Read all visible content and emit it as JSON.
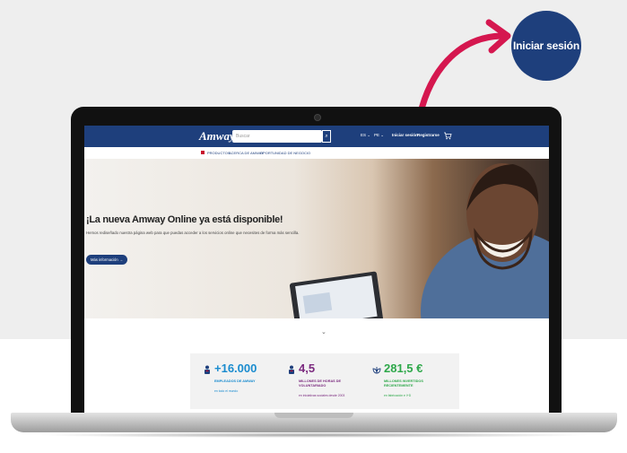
{
  "callout": {
    "label": "Iniciar sesión"
  },
  "header": {
    "logo": "Amway",
    "search_placeholder": "Buscar",
    "lang": "ES",
    "country": "PE",
    "login": "Iniciar sesión",
    "register": "Registrarse"
  },
  "subnav": {
    "items": [
      "PRODUCTOS",
      "ACERCA DE AMWAY",
      "OPORTUNIDAD DE NEGOCIO"
    ]
  },
  "hero": {
    "title": "¡La nueva Amway Online ya está disponible!",
    "subtitle": "Hemos rediseñado nuestra página web para que puedas acceder a los servicios online que necesites de forma más sencilla.",
    "button": "Más información →"
  },
  "stats": [
    {
      "value": "+16.000",
      "label": "EMPLEADOS DE AMWAY",
      "sub": "en todo el mundo",
      "color": "#1a8ccf",
      "icon": "people-icon"
    },
    {
      "value": "4,5",
      "label": "MILLONES DE HORAS DE VOLUNTARIADO",
      "sub": "en iniciativas sociales desde 2003",
      "color": "#7b2a7f",
      "icon": "hands-icon"
    },
    {
      "value": "281,5 €",
      "label": "MILLONES INVERTIDOS RECIENTEMENTE",
      "sub": "en fabricación e I+D",
      "color": "#2ea84a",
      "icon": "plant-icon"
    }
  ],
  "colors": {
    "brand": "#1e3f7c",
    "arrow": "#d5174f"
  }
}
